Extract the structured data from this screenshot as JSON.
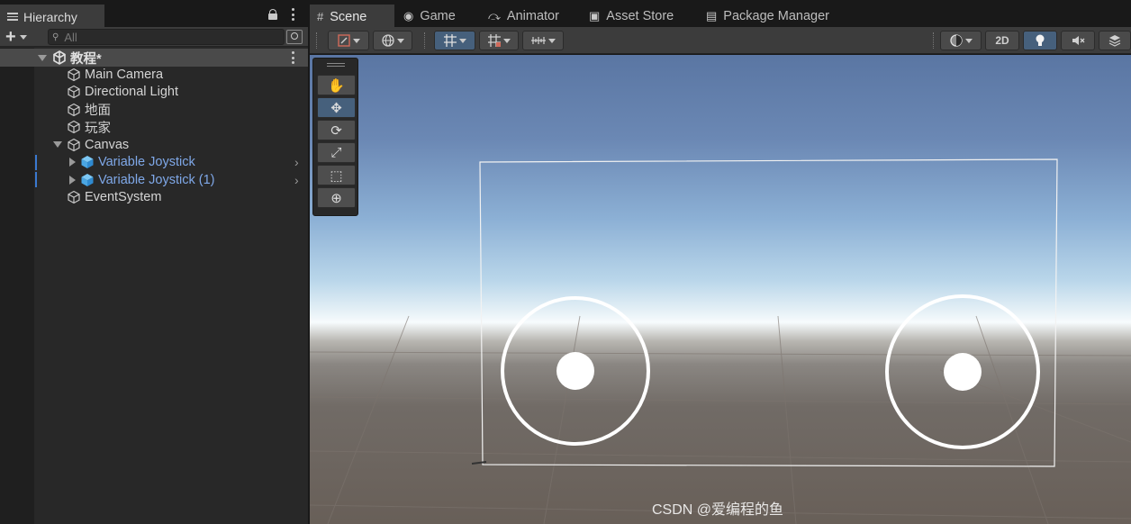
{
  "hierarchy": {
    "tab_label": "Hierarchy",
    "add_label": "+",
    "search_placeholder": "All",
    "scene_name": "教程*",
    "items": [
      {
        "label": "Main Camera"
      },
      {
        "label": "Directional Light"
      },
      {
        "label": "地面"
      },
      {
        "label": "玩家"
      },
      {
        "label": "Canvas"
      },
      {
        "label": "Variable Joystick",
        "prefab": true
      },
      {
        "label": "Variable Joystick (1)",
        "prefab": true
      },
      {
        "label": "EventSystem"
      }
    ]
  },
  "scene_tabs": [
    {
      "label": "Scene",
      "icon": "grid-icon",
      "active": true
    },
    {
      "label": "Game",
      "icon": "gamepad-icon"
    },
    {
      "label": "Animator",
      "icon": "animator-icon"
    },
    {
      "label": "Asset Store",
      "icon": "store-bag-icon"
    },
    {
      "label": "Package Manager",
      "icon": "package-icon"
    }
  ],
  "scene_toolbar": {
    "mode_2d_label": "2D"
  },
  "tools": [
    {
      "name": "hand-tool",
      "glyph": "✋"
    },
    {
      "name": "move-tool",
      "glyph": "✥",
      "active": true
    },
    {
      "name": "rotate-tool",
      "glyph": "⟳"
    },
    {
      "name": "scale-tool",
      "glyph": "⤢"
    },
    {
      "name": "rect-tool",
      "glyph": "⬚"
    },
    {
      "name": "transform-tool",
      "glyph": "⊕"
    }
  ],
  "watermark": "CSDN @爱编程的鱼",
  "colors": {
    "selection_blue": "#3a79d0",
    "prefab_text": "#7fa8e8",
    "active_button": "#46607c"
  }
}
